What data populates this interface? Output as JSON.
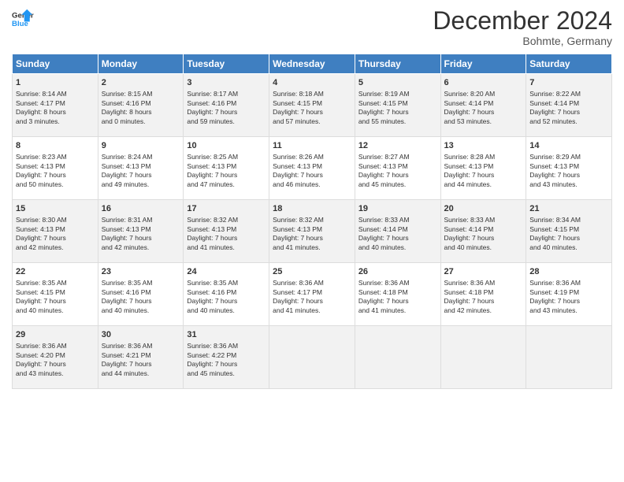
{
  "header": {
    "logo_general": "General",
    "logo_blue": "Blue",
    "month_title": "December 2024",
    "subtitle": "Bohmte, Germany"
  },
  "days_of_week": [
    "Sunday",
    "Monday",
    "Tuesday",
    "Wednesday",
    "Thursday",
    "Friday",
    "Saturday"
  ],
  "weeks": [
    [
      {
        "num": "1",
        "info": "Sunrise: 8:14 AM\nSunset: 4:17 PM\nDaylight: 8 hours\nand 3 minutes."
      },
      {
        "num": "2",
        "info": "Sunrise: 8:15 AM\nSunset: 4:16 PM\nDaylight: 8 hours\nand 0 minutes."
      },
      {
        "num": "3",
        "info": "Sunrise: 8:17 AM\nSunset: 4:16 PM\nDaylight: 7 hours\nand 59 minutes."
      },
      {
        "num": "4",
        "info": "Sunrise: 8:18 AM\nSunset: 4:15 PM\nDaylight: 7 hours\nand 57 minutes."
      },
      {
        "num": "5",
        "info": "Sunrise: 8:19 AM\nSunset: 4:15 PM\nDaylight: 7 hours\nand 55 minutes."
      },
      {
        "num": "6",
        "info": "Sunrise: 8:20 AM\nSunset: 4:14 PM\nDaylight: 7 hours\nand 53 minutes."
      },
      {
        "num": "7",
        "info": "Sunrise: 8:22 AM\nSunset: 4:14 PM\nDaylight: 7 hours\nand 52 minutes."
      }
    ],
    [
      {
        "num": "8",
        "info": "Sunrise: 8:23 AM\nSunset: 4:13 PM\nDaylight: 7 hours\nand 50 minutes."
      },
      {
        "num": "9",
        "info": "Sunrise: 8:24 AM\nSunset: 4:13 PM\nDaylight: 7 hours\nand 49 minutes."
      },
      {
        "num": "10",
        "info": "Sunrise: 8:25 AM\nSunset: 4:13 PM\nDaylight: 7 hours\nand 47 minutes."
      },
      {
        "num": "11",
        "info": "Sunrise: 8:26 AM\nSunset: 4:13 PM\nDaylight: 7 hours\nand 46 minutes."
      },
      {
        "num": "12",
        "info": "Sunrise: 8:27 AM\nSunset: 4:13 PM\nDaylight: 7 hours\nand 45 minutes."
      },
      {
        "num": "13",
        "info": "Sunrise: 8:28 AM\nSunset: 4:13 PM\nDaylight: 7 hours\nand 44 minutes."
      },
      {
        "num": "14",
        "info": "Sunrise: 8:29 AM\nSunset: 4:13 PM\nDaylight: 7 hours\nand 43 minutes."
      }
    ],
    [
      {
        "num": "15",
        "info": "Sunrise: 8:30 AM\nSunset: 4:13 PM\nDaylight: 7 hours\nand 42 minutes."
      },
      {
        "num": "16",
        "info": "Sunrise: 8:31 AM\nSunset: 4:13 PM\nDaylight: 7 hours\nand 42 minutes."
      },
      {
        "num": "17",
        "info": "Sunrise: 8:32 AM\nSunset: 4:13 PM\nDaylight: 7 hours\nand 41 minutes."
      },
      {
        "num": "18",
        "info": "Sunrise: 8:32 AM\nSunset: 4:13 PM\nDaylight: 7 hours\nand 41 minutes."
      },
      {
        "num": "19",
        "info": "Sunrise: 8:33 AM\nSunset: 4:14 PM\nDaylight: 7 hours\nand 40 minutes."
      },
      {
        "num": "20",
        "info": "Sunrise: 8:33 AM\nSunset: 4:14 PM\nDaylight: 7 hours\nand 40 minutes."
      },
      {
        "num": "21",
        "info": "Sunrise: 8:34 AM\nSunset: 4:15 PM\nDaylight: 7 hours\nand 40 minutes."
      }
    ],
    [
      {
        "num": "22",
        "info": "Sunrise: 8:35 AM\nSunset: 4:15 PM\nDaylight: 7 hours\nand 40 minutes."
      },
      {
        "num": "23",
        "info": "Sunrise: 8:35 AM\nSunset: 4:16 PM\nDaylight: 7 hours\nand 40 minutes."
      },
      {
        "num": "24",
        "info": "Sunrise: 8:35 AM\nSunset: 4:16 PM\nDaylight: 7 hours\nand 40 minutes."
      },
      {
        "num": "25",
        "info": "Sunrise: 8:36 AM\nSunset: 4:17 PM\nDaylight: 7 hours\nand 41 minutes."
      },
      {
        "num": "26",
        "info": "Sunrise: 8:36 AM\nSunset: 4:18 PM\nDaylight: 7 hours\nand 41 minutes."
      },
      {
        "num": "27",
        "info": "Sunrise: 8:36 AM\nSunset: 4:18 PM\nDaylight: 7 hours\nand 42 minutes."
      },
      {
        "num": "28",
        "info": "Sunrise: 8:36 AM\nSunset: 4:19 PM\nDaylight: 7 hours\nand 43 minutes."
      }
    ],
    [
      {
        "num": "29",
        "info": "Sunrise: 8:36 AM\nSunset: 4:20 PM\nDaylight: 7 hours\nand 43 minutes."
      },
      {
        "num": "30",
        "info": "Sunrise: 8:36 AM\nSunset: 4:21 PM\nDaylight: 7 hours\nand 44 minutes."
      },
      {
        "num": "31",
        "info": "Sunrise: 8:36 AM\nSunset: 4:22 PM\nDaylight: 7 hours\nand 45 minutes."
      },
      {
        "num": "",
        "info": ""
      },
      {
        "num": "",
        "info": ""
      },
      {
        "num": "",
        "info": ""
      },
      {
        "num": "",
        "info": ""
      }
    ]
  ]
}
